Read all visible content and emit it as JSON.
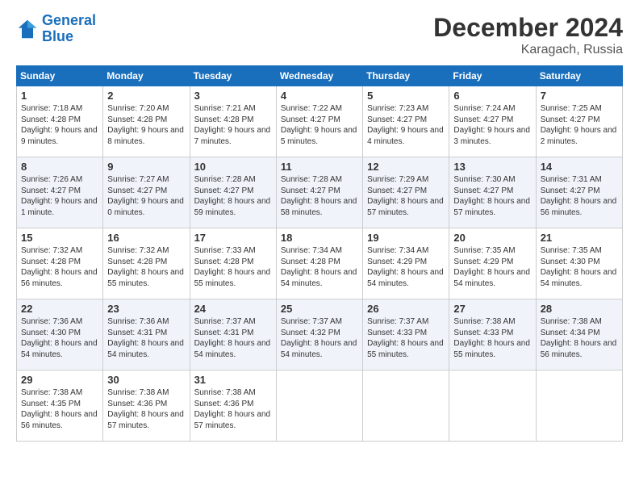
{
  "logo": {
    "line1": "General",
    "line2": "Blue"
  },
  "title": "December 2024",
  "location": "Karagach, Russia",
  "days_header": [
    "Sunday",
    "Monday",
    "Tuesday",
    "Wednesday",
    "Thursday",
    "Friday",
    "Saturday"
  ],
  "weeks": [
    [
      {
        "day": "1",
        "sunrise": "7:18 AM",
        "sunset": "4:28 PM",
        "daylight": "9 hours and 9 minutes."
      },
      {
        "day": "2",
        "sunrise": "7:20 AM",
        "sunset": "4:28 PM",
        "daylight": "9 hours and 8 minutes."
      },
      {
        "day": "3",
        "sunrise": "7:21 AM",
        "sunset": "4:28 PM",
        "daylight": "9 hours and 7 minutes."
      },
      {
        "day": "4",
        "sunrise": "7:22 AM",
        "sunset": "4:27 PM",
        "daylight": "9 hours and 5 minutes."
      },
      {
        "day": "5",
        "sunrise": "7:23 AM",
        "sunset": "4:27 PM",
        "daylight": "9 hours and 4 minutes."
      },
      {
        "day": "6",
        "sunrise": "7:24 AM",
        "sunset": "4:27 PM",
        "daylight": "9 hours and 3 minutes."
      },
      {
        "day": "7",
        "sunrise": "7:25 AM",
        "sunset": "4:27 PM",
        "daylight": "9 hours and 2 minutes."
      }
    ],
    [
      {
        "day": "8",
        "sunrise": "7:26 AM",
        "sunset": "4:27 PM",
        "daylight": "9 hours and 1 minute."
      },
      {
        "day": "9",
        "sunrise": "7:27 AM",
        "sunset": "4:27 PM",
        "daylight": "9 hours and 0 minutes."
      },
      {
        "day": "10",
        "sunrise": "7:28 AM",
        "sunset": "4:27 PM",
        "daylight": "8 hours and 59 minutes."
      },
      {
        "day": "11",
        "sunrise": "7:28 AM",
        "sunset": "4:27 PM",
        "daylight": "8 hours and 58 minutes."
      },
      {
        "day": "12",
        "sunrise": "7:29 AM",
        "sunset": "4:27 PM",
        "daylight": "8 hours and 57 minutes."
      },
      {
        "day": "13",
        "sunrise": "7:30 AM",
        "sunset": "4:27 PM",
        "daylight": "8 hours and 57 minutes."
      },
      {
        "day": "14",
        "sunrise": "7:31 AM",
        "sunset": "4:27 PM",
        "daylight": "8 hours and 56 minutes."
      }
    ],
    [
      {
        "day": "15",
        "sunrise": "7:32 AM",
        "sunset": "4:28 PM",
        "daylight": "8 hours and 56 minutes."
      },
      {
        "day": "16",
        "sunrise": "7:32 AM",
        "sunset": "4:28 PM",
        "daylight": "8 hours and 55 minutes."
      },
      {
        "day": "17",
        "sunrise": "7:33 AM",
        "sunset": "4:28 PM",
        "daylight": "8 hours and 55 minutes."
      },
      {
        "day": "18",
        "sunrise": "7:34 AM",
        "sunset": "4:28 PM",
        "daylight": "8 hours and 54 minutes."
      },
      {
        "day": "19",
        "sunrise": "7:34 AM",
        "sunset": "4:29 PM",
        "daylight": "8 hours and 54 minutes."
      },
      {
        "day": "20",
        "sunrise": "7:35 AM",
        "sunset": "4:29 PM",
        "daylight": "8 hours and 54 minutes."
      },
      {
        "day": "21",
        "sunrise": "7:35 AM",
        "sunset": "4:30 PM",
        "daylight": "8 hours and 54 minutes."
      }
    ],
    [
      {
        "day": "22",
        "sunrise": "7:36 AM",
        "sunset": "4:30 PM",
        "daylight": "8 hours and 54 minutes."
      },
      {
        "day": "23",
        "sunrise": "7:36 AM",
        "sunset": "4:31 PM",
        "daylight": "8 hours and 54 minutes."
      },
      {
        "day": "24",
        "sunrise": "7:37 AM",
        "sunset": "4:31 PM",
        "daylight": "8 hours and 54 minutes."
      },
      {
        "day": "25",
        "sunrise": "7:37 AM",
        "sunset": "4:32 PM",
        "daylight": "8 hours and 54 minutes."
      },
      {
        "day": "26",
        "sunrise": "7:37 AM",
        "sunset": "4:33 PM",
        "daylight": "8 hours and 55 minutes."
      },
      {
        "day": "27",
        "sunrise": "7:38 AM",
        "sunset": "4:33 PM",
        "daylight": "8 hours and 55 minutes."
      },
      {
        "day": "28",
        "sunrise": "7:38 AM",
        "sunset": "4:34 PM",
        "daylight": "8 hours and 56 minutes."
      }
    ],
    [
      {
        "day": "29",
        "sunrise": "7:38 AM",
        "sunset": "4:35 PM",
        "daylight": "8 hours and 56 minutes."
      },
      {
        "day": "30",
        "sunrise": "7:38 AM",
        "sunset": "4:36 PM",
        "daylight": "8 hours and 57 minutes."
      },
      {
        "day": "31",
        "sunrise": "7:38 AM",
        "sunset": "4:36 PM",
        "daylight": "8 hours and 57 minutes."
      },
      null,
      null,
      null,
      null
    ]
  ]
}
